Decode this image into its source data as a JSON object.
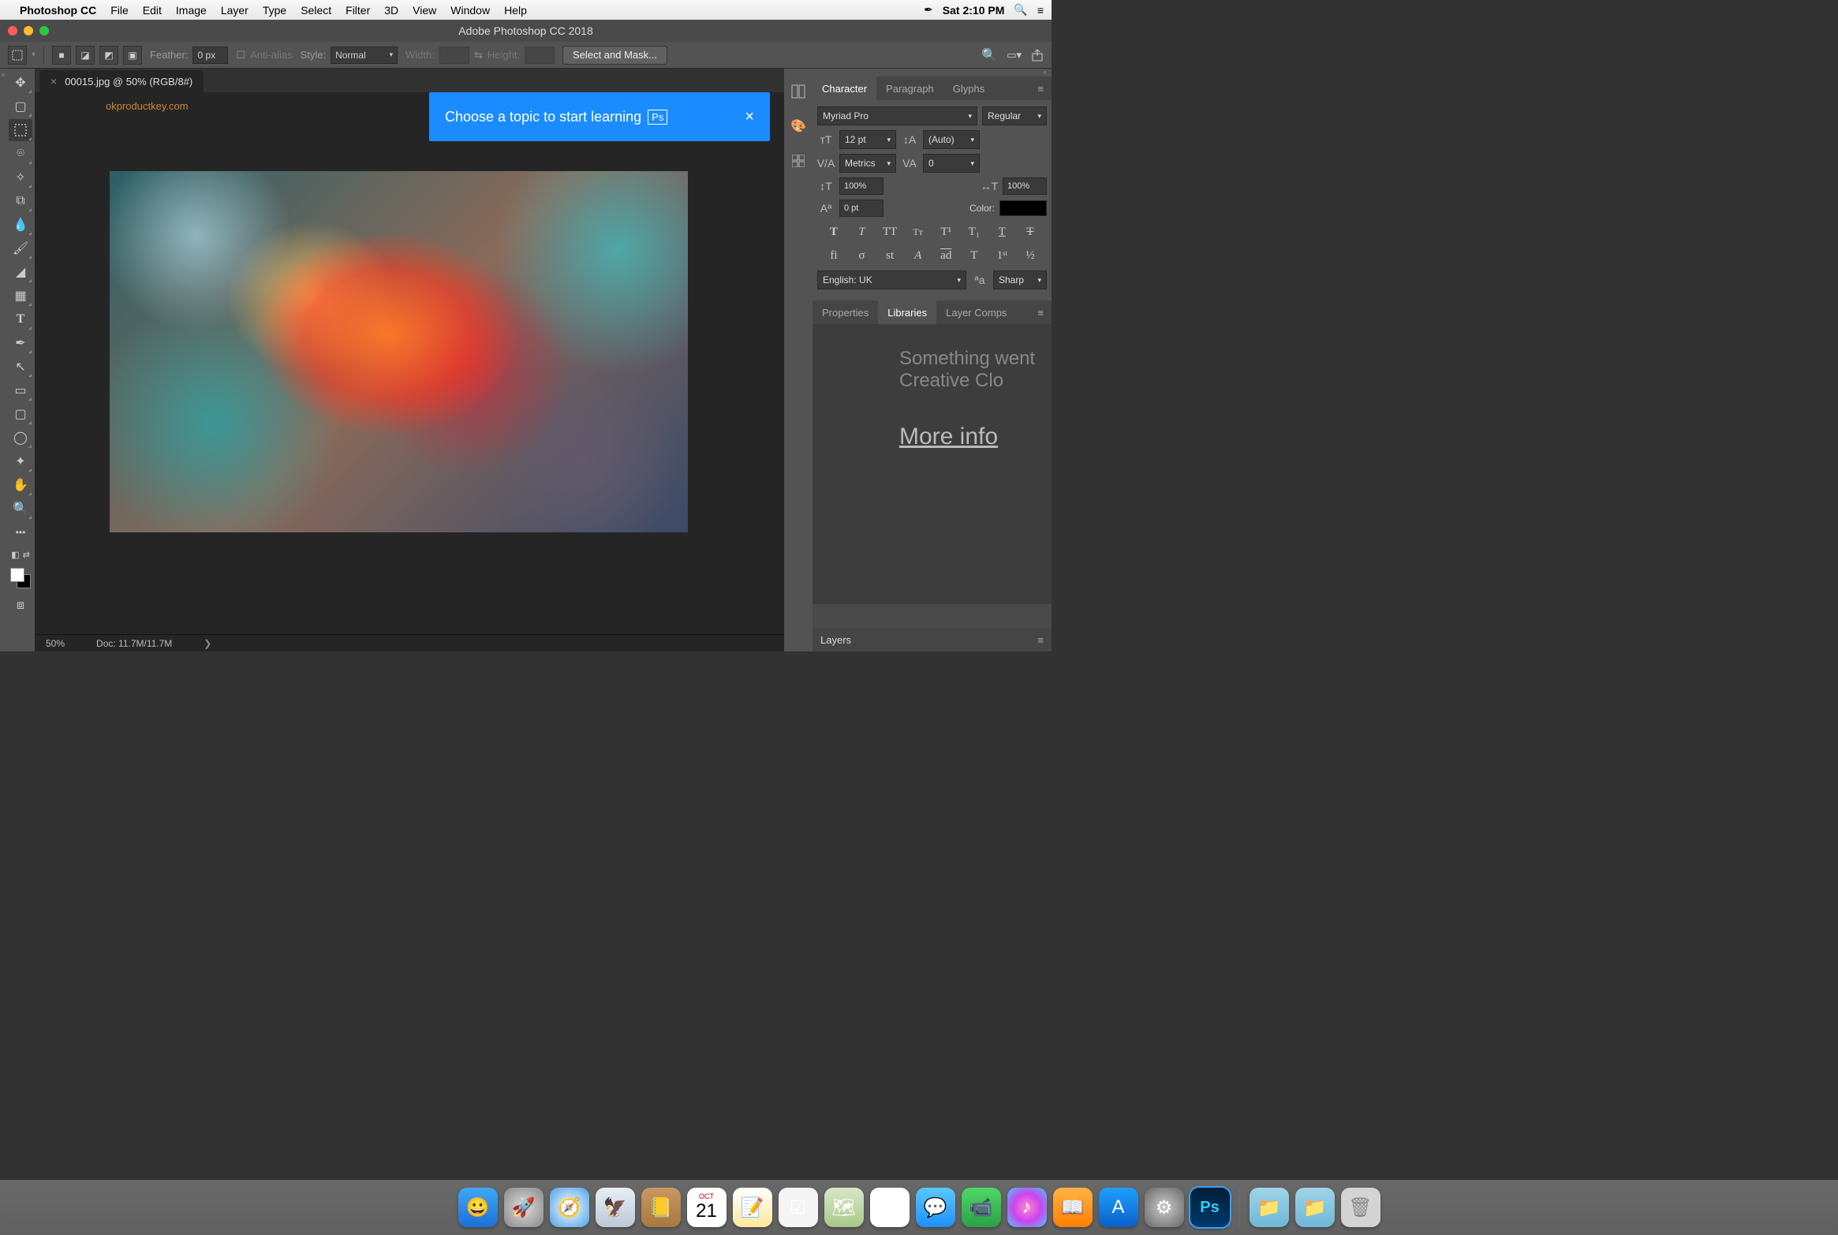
{
  "menubar": {
    "app": "Photoshop CC",
    "items": [
      "File",
      "Edit",
      "Image",
      "Layer",
      "Type",
      "Select",
      "Filter",
      "3D",
      "View",
      "Window",
      "Help"
    ],
    "clock": "Sat 2:10 PM"
  },
  "window": {
    "title": "Adobe Photoshop CC 2018"
  },
  "optbar": {
    "feather_label": "Feather:",
    "feather_value": "0 px",
    "antialias": "Anti-alias",
    "style_label": "Style:",
    "style_value": "Normal",
    "width_label": "Width:",
    "height_label": "Height:",
    "select_mask": "Select and Mask..."
  },
  "doc": {
    "tab": "00015.jpg @ 50% (RGB/8#)",
    "watermark": "okproductkey.com",
    "zoom": "50%",
    "docinfo": "Doc: 11.7M/11.7M"
  },
  "learn": {
    "text": "Choose a topic to start learning",
    "badge": "Ps"
  },
  "char": {
    "tabs": [
      "Character",
      "Paragraph",
      "Glyphs"
    ],
    "font": "Myriad Pro",
    "style": "Regular",
    "size": "12 pt",
    "leading": "(Auto)",
    "kerning": "Metrics",
    "tracking": "0",
    "vscale": "100%",
    "hscale": "100%",
    "baseline": "0 pt",
    "color_label": "Color:",
    "lang": "English: UK",
    "aa": "Sharp"
  },
  "lib": {
    "tabs": [
      "Properties",
      "Libraries",
      "Layer Comps"
    ],
    "line1": "Something went",
    "line2": "Creative Clo",
    "link": "More info"
  },
  "layers": {
    "title": "Layers"
  },
  "dock": {
    "items": [
      {
        "name": "finder",
        "bg": "linear-gradient(#3fa8f4,#1d6fd6)",
        "glyph": "😀"
      },
      {
        "name": "launchpad",
        "bg": "radial-gradient(circle,#ddd,#888)",
        "glyph": "🚀"
      },
      {
        "name": "safari",
        "bg": "radial-gradient(circle,#fff,#4aa0e8)",
        "glyph": "🧭"
      },
      {
        "name": "mail",
        "bg": "linear-gradient(#e8eef5,#bcc8d8)",
        "glyph": "🦅"
      },
      {
        "name": "contacts",
        "bg": "linear-gradient(#c89860,#a87840)",
        "glyph": "📒"
      },
      {
        "name": "calendar",
        "bg": "#fff",
        "glyph": "21"
      },
      {
        "name": "notes",
        "bg": "linear-gradient(#fff,#ffe89a)",
        "glyph": "📝"
      },
      {
        "name": "reminders",
        "bg": "#f5f5f5",
        "glyph": "☑"
      },
      {
        "name": "maps",
        "bg": "linear-gradient(#d8e8c8,#a8c888)",
        "glyph": "🗺"
      },
      {
        "name": "photos",
        "bg": "#fff",
        "glyph": "✿"
      },
      {
        "name": "messages",
        "bg": "linear-gradient(#5ac8fa,#1e90ff)",
        "glyph": "💬"
      },
      {
        "name": "facetime",
        "bg": "linear-gradient(#4cd964,#2aa148)",
        "glyph": "📹"
      },
      {
        "name": "itunes",
        "bg": "radial-gradient(circle,#f8c,#c4e,#4cf)",
        "glyph": "♪"
      },
      {
        "name": "ibooks",
        "bg": "linear-gradient(#ffb347,#ff7f00)",
        "glyph": "📖"
      },
      {
        "name": "appstore",
        "bg": "linear-gradient(#1ea0ff,#0a60c8)",
        "glyph": "A"
      },
      {
        "name": "settings",
        "bg": "radial-gradient(circle,#ccc,#666)",
        "glyph": "⚙"
      },
      {
        "name": "photoshop",
        "bg": "linear-gradient(#001e36,#003a6b)",
        "glyph": "Ps"
      }
    ],
    "extra": [
      {
        "name": "folder1",
        "bg": "linear-gradient(#9fd4e8,#6fb8d8)",
        "glyph": "📁"
      },
      {
        "name": "folder2",
        "bg": "linear-gradient(#9fd4e8,#6fb8d8)",
        "glyph": "📁"
      },
      {
        "name": "trash",
        "bg": "rgba(240,240,240,0.8)",
        "glyph": "🗑"
      }
    ]
  }
}
